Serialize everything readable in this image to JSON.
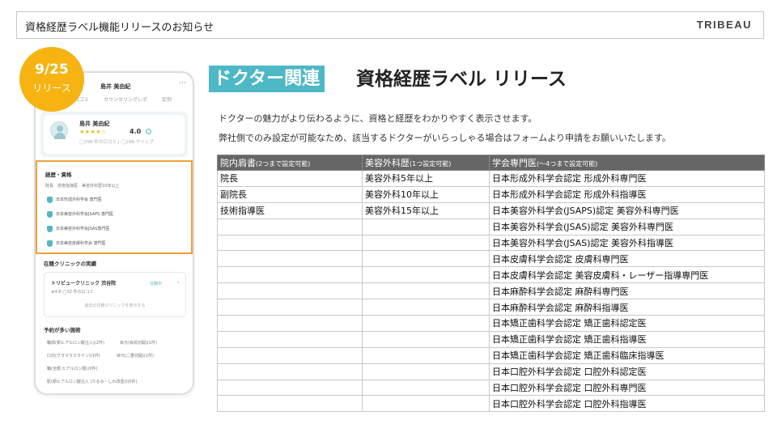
{
  "header": {
    "title": "資格経歴ラベル機能リリースのお知らせ",
    "logo": "TRIBEAU"
  },
  "date_badge": {
    "date": "9/25",
    "label": "リリース"
  },
  "phone": {
    "doctor_name_top": "島井 美由紀",
    "tabs": [
      "口コミ",
      "カウンセリングレポ",
      "症例"
    ],
    "doctor_name": "島井 美由紀",
    "stars": "★★★★☆",
    "rating": "4.0",
    "counts": "◯298 件の口コミ | ◯298 クリップ",
    "career_heading": "経歴・資格",
    "career_sub": "院長　技術指導医　美容外科歴10年以上",
    "badges": [
      "日本形成外科学会 専門医",
      "日本美容外科学会JSAPS 専門医",
      "日本美容外科学会JSAS専門医",
      "日本美容皮膚科学会 専門医"
    ],
    "clinic_heading": "在籍クリニックの実績",
    "clinic_name": "トリビュークリニック 渋谷院",
    "clinic_meta": "★4.8 ◯32 件の口コミ",
    "clinic_tag": "在籍中",
    "clinic_more": "過去の在籍クリニックを表示する",
    "procedures_heading": "予約が多い施術",
    "procedures": [
      "輪郭(頬ヒアルロン酸注入)(2件)",
      "目元(目尻切開)(1件)",
      "口元(グラマラスライン)(1件)",
      "目元(二重切開)(1件)",
      "輪(全顔 ヒアルロン酸)(0件)",
      "肌(頬ヒアルロン酸注入 (たるみ・しわ改善))(0件)"
    ]
  },
  "tag": "ドクター関連",
  "main_title": "資格経歴ラベル リリース",
  "desc": [
    "ドクターの魅力がより伝わるように、資格と経歴をわかりやすく表示させます。",
    "弊社側でのみ設定が可能なため、該当するドクターがいらっしゃる場合はフォームより申請をお願いいたします。"
  ],
  "table": {
    "headers": [
      {
        "label": "院内肩書",
        "note": "(2つまで設定可能)"
      },
      {
        "label": "美容外科歴",
        "note": "(1つ設定可能)"
      },
      {
        "label": "学会専門医",
        "note": "(～4つまで設定可能)"
      }
    ],
    "rows": [
      [
        "院長",
        "美容外科5年以上",
        "日本形成外科学会認定 形成外科専門医"
      ],
      [
        "副院長",
        "美容外科10年以上",
        "日本形成外科学会認定 形成外科指導医"
      ],
      [
        "技術指導医",
        "美容外科15年以上",
        "日本美容外科学会(JSAPS)認定 美容外科専門医"
      ],
      [
        "",
        "",
        "日本美容外科学会(JSAS)認定 美容外科専門医"
      ],
      [
        "",
        "",
        "日本美容外科学会(JSAS)認定 美容外科指導医"
      ],
      [
        "",
        "",
        "日本皮膚科学会認定 皮膚科専門医"
      ],
      [
        "",
        "",
        "日本皮膚科学会認定 美容皮膚科・レーザー指導専門医"
      ],
      [
        "",
        "",
        "日本麻酔科学会認定 麻酔科専門医"
      ],
      [
        "",
        "",
        "日本麻酔科学会認定 麻酔科指導医"
      ],
      [
        "",
        "",
        "日本矯正歯科学会認定 矯正歯科認定医"
      ],
      [
        "",
        "",
        "日本矯正歯科学会認定 矯正歯科指導医"
      ],
      [
        "",
        "",
        "日本矯正歯科学会認定 矯正歯科臨床指導医"
      ],
      [
        "",
        "",
        "日本口腔外科学会認定 口腔外科認定医"
      ],
      [
        "",
        "",
        "日本口腔外科学会認定 口腔外科専門医"
      ],
      [
        "",
        "",
        "日本口腔外科学会認定 口腔外科指導医"
      ]
    ]
  },
  "colors": {
    "accent": "#4db8c6",
    "badge": "#f6b312",
    "highlight": "#f0a03c",
    "table_header": "#666666"
  }
}
